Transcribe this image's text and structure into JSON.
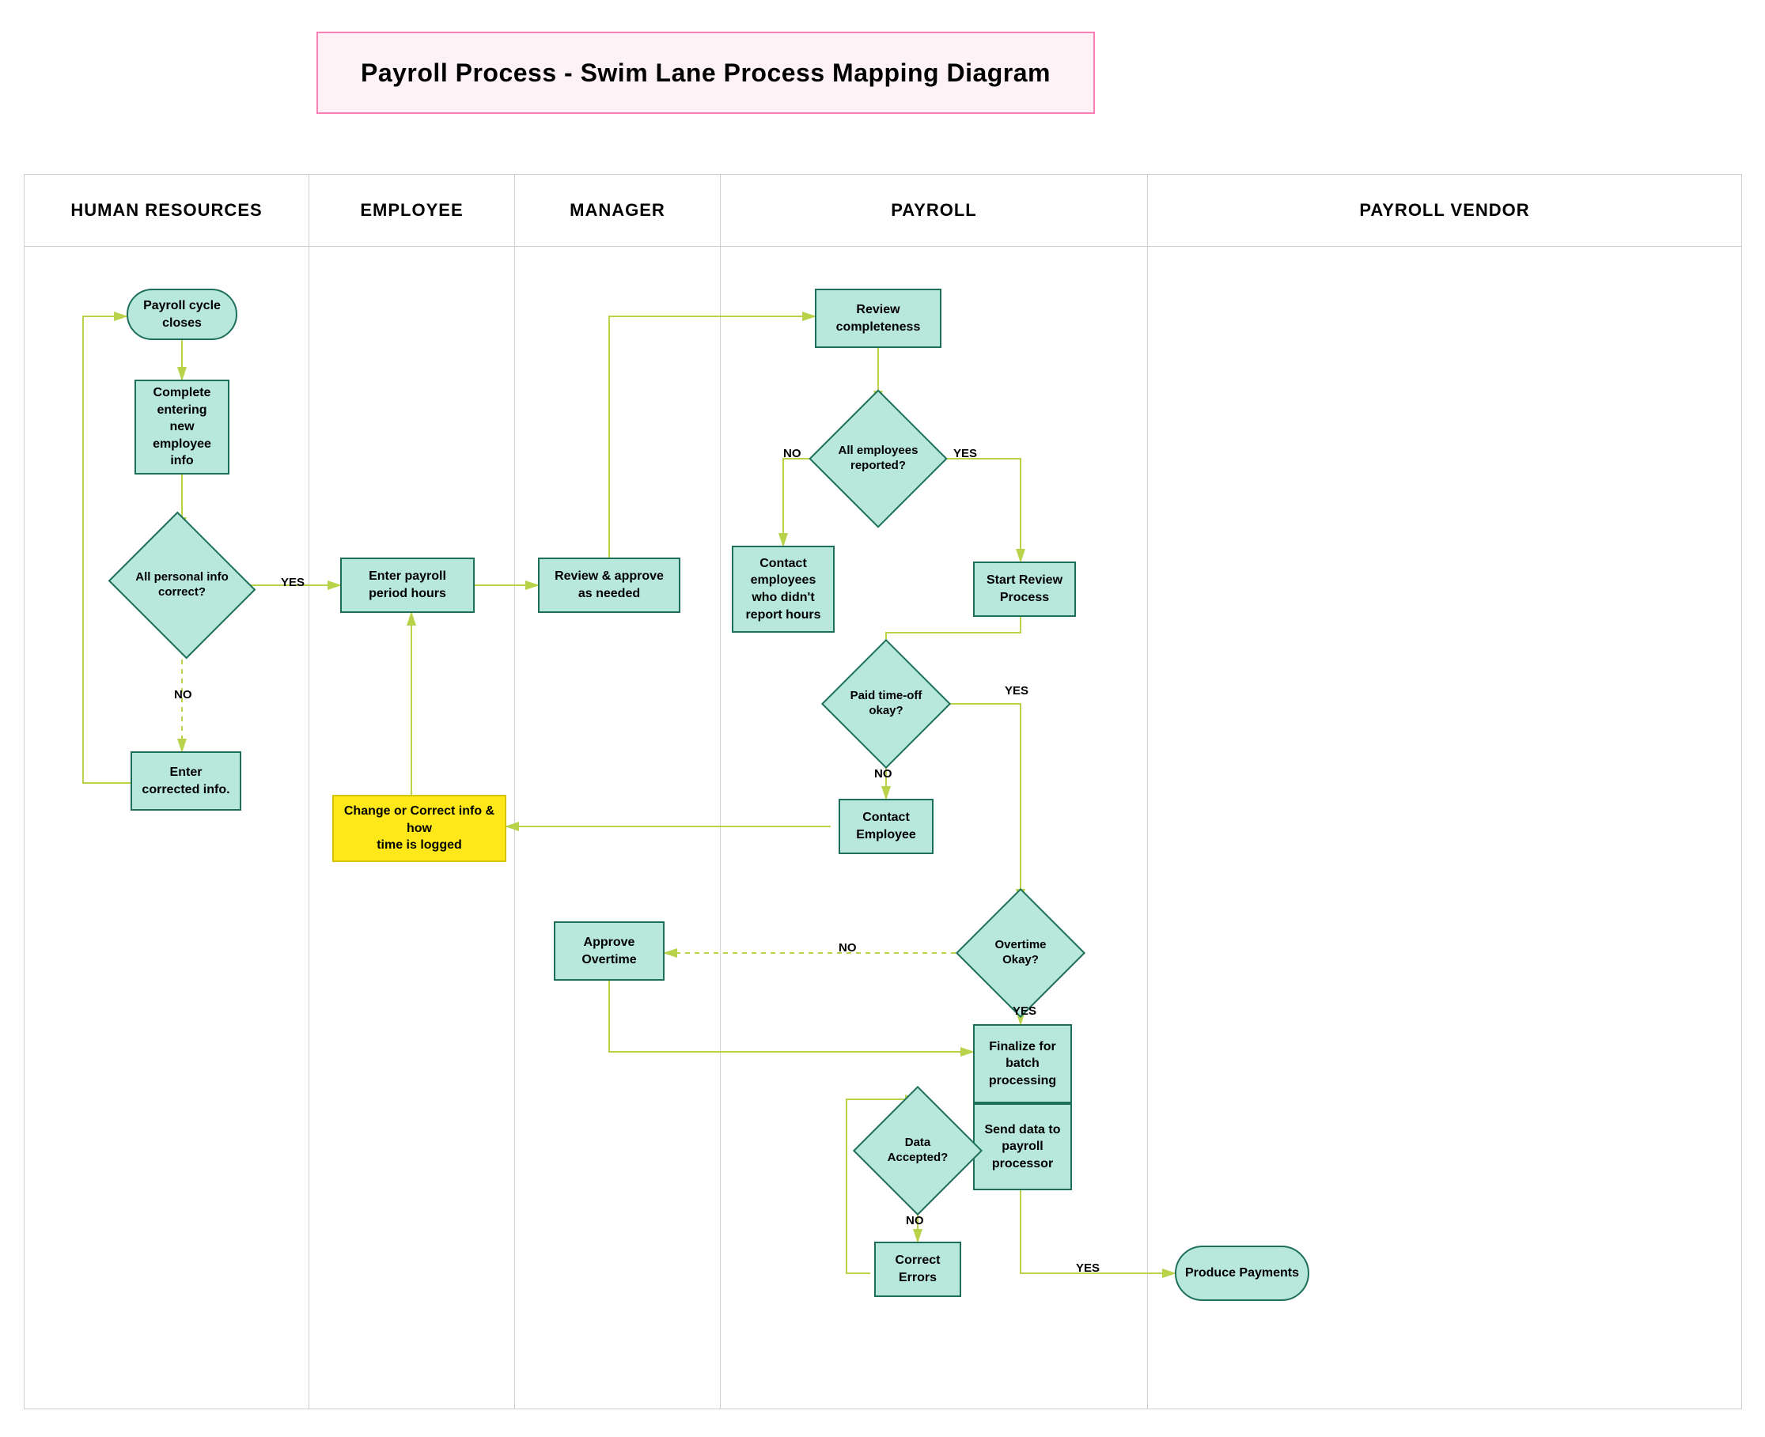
{
  "title": "Payroll Process - Swim Lane Process Mapping Diagram",
  "lanes": {
    "hr": "HUMAN RESOURCES",
    "employee": "EMPLOYEE",
    "manager": "MANAGER",
    "payroll": "PAYROLL",
    "vendor": "PAYROLL VENDOR"
  },
  "nodes": {
    "start": "Payroll cycle closes",
    "complete_entering": "Complete entering\nnew employee info",
    "all_personal_info": "All personal info correct?",
    "enter_corrected": "Enter corrected info.",
    "enter_payroll_hours": "Enter payroll period hours",
    "review_approve": "Review & approve as needed",
    "change_correct": "Change or Correct info & how\ntime is logged",
    "review_completeness": "Review completeness",
    "all_employees_reported": "All employees reported?",
    "contact_didnt_report": "Contact employees who didn't report hours",
    "start_review_process": "Start Review Process",
    "paid_timeoff_ok": "Paid time-off okay?",
    "contact_employee": "Contact Employee",
    "overtime_ok": "Overtime Okay?",
    "approve_overtime": "Approve Overtime",
    "finalize_batch": "Finalize for batch processing",
    "send_data": "Send data to payroll processor",
    "data_accepted": "Data Accepted?",
    "correct_errors": "Correct Errors",
    "produce_payments": "Produce Payments"
  },
  "labels": {
    "yes": "YES",
    "no": "NO"
  },
  "colors": {
    "shape_fill": "#b8e8db",
    "shape_border": "#1d6f5a",
    "highlight_fill": "#ffe81a",
    "connector": "#b8d24a",
    "title_border": "#ff7fb4",
    "title_bg": "#fff2f7",
    "grid": "#cfcfcf"
  }
}
